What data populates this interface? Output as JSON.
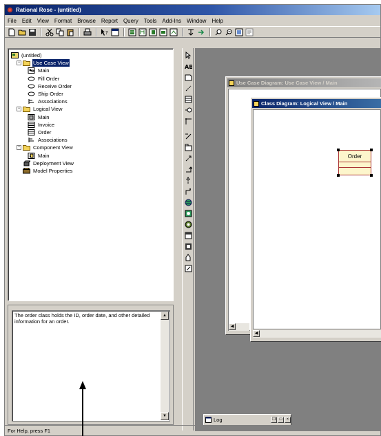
{
  "window": {
    "title": "Rational Rose - (untitled)"
  },
  "menu": [
    "File",
    "Edit",
    "View",
    "Format",
    "Browse",
    "Report",
    "Query",
    "Tools",
    "Add-Ins",
    "Window",
    "Help"
  ],
  "toolbar_icons": [
    "new-icon",
    "open-icon",
    "save-icon",
    "cut-icon",
    "copy-icon",
    "paste-icon",
    "print-icon",
    "context-help-icon",
    "view-doc-icon",
    "browse-class-icon",
    "browse-interaction-icon",
    "browse-component-icon",
    "browse-deployment-icon",
    "browse-parent-icon",
    "browse-previous-icon",
    "zoom-in-icon",
    "zoom-out-icon",
    "fit-window-icon",
    "undo-fit-icon"
  ],
  "tree": {
    "root": "(untitled)",
    "use_case_view": {
      "label": "Use Case View",
      "children": [
        "Main",
        "Fill Order",
        "Receive Order",
        "Ship Order",
        "Associations"
      ]
    },
    "logical_view": {
      "label": "Logical View",
      "children": [
        "Main",
        "Invoice",
        "Order",
        "Associations"
      ]
    },
    "component_view": {
      "label": "Component View",
      "children": [
        "Main"
      ]
    },
    "deployment_view": "Deployment View",
    "model_properties": "Model Properties"
  },
  "documentation": {
    "text": "The order class holds the ID, order date, and other detailed information for an order."
  },
  "windows": {
    "use_case_diagram": "Use Case Diagram: Use Case View / Main",
    "class_diagram": "Class Diagram: Logical View / Main"
  },
  "diagram": {
    "class_name": "Order"
  },
  "minimized": {
    "label": "Log"
  },
  "status": {
    "text": "For Help, press F1"
  },
  "colors": {
    "title_active": "#0a246a",
    "class_fill": "#fdf6cc",
    "class_border": "#aa3333",
    "selection": "#0a246a"
  }
}
